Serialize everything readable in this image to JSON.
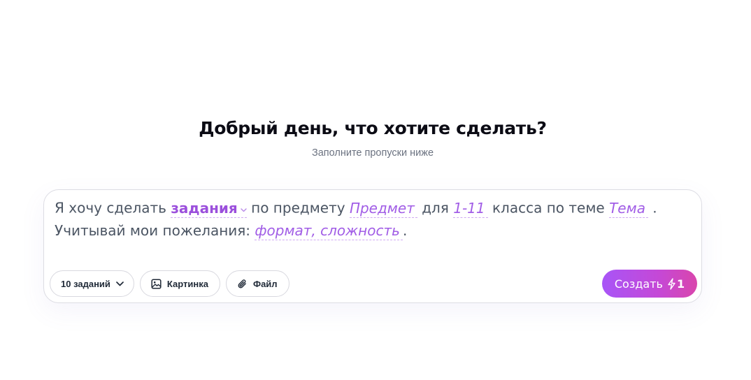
{
  "header": {
    "title": "Добрый день, что хотите сделать?",
    "subtitle": "Заполните пропуски ниже"
  },
  "prompt": {
    "line1": {
      "prefix": "Я хочу сделать ",
      "type_value": "задания",
      "after_type": " по предмету ",
      "subject_value": "Предмет",
      "for_text": " для ",
      "grade_value": "1-11",
      "grade_suffix": " класса по теме ",
      "topic_value": "Тема",
      "end": " ."
    },
    "line2": {
      "prefix": "Учитывай мои пожелания: ",
      "wishes_value": "формат, сложность",
      "end": "."
    }
  },
  "toolbar": {
    "count_label": "10 заданий",
    "image_label": "Картинка",
    "file_label": "Файл",
    "icons": {
      "count": "chevron-down-icon",
      "image": "image-icon",
      "file": "paperclip-icon"
    }
  },
  "submit": {
    "label": "Создать",
    "cost": "1",
    "icon": "lightning-icon"
  },
  "colors": {
    "accent": "#a855f7",
    "accent_end": "#d946ac",
    "blank_text": "#a15de6",
    "heading": "#0b0b14",
    "muted": "#6b7280"
  }
}
